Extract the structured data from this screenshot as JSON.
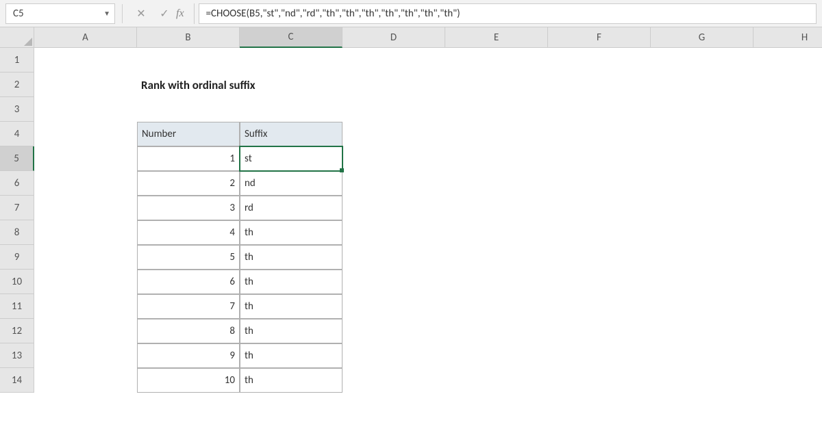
{
  "formula_bar": {
    "name_box": "C5",
    "formula": "=CHOOSE(B5,\"st\",\"nd\",\"rd\",\"th\",\"th\",\"th\",\"th\",\"th\",\"th\",\"th\")"
  },
  "columns": [
    "A",
    "B",
    "C",
    "D",
    "E",
    "F",
    "G",
    "H"
  ],
  "rows": [
    "1",
    "2",
    "3",
    "4",
    "5",
    "6",
    "7",
    "8",
    "9",
    "10",
    "11",
    "12",
    "13",
    "14"
  ],
  "title": "Rank with ordinal suffix",
  "table": {
    "headers": {
      "number": "Number",
      "suffix": "Suffix"
    },
    "rows": [
      {
        "number": "1",
        "suffix": "st"
      },
      {
        "number": "2",
        "suffix": "nd"
      },
      {
        "number": "3",
        "suffix": "rd"
      },
      {
        "number": "4",
        "suffix": "th"
      },
      {
        "number": "5",
        "suffix": "th"
      },
      {
        "number": "6",
        "suffix": "th"
      },
      {
        "number": "7",
        "suffix": "th"
      },
      {
        "number": "8",
        "suffix": "th"
      },
      {
        "number": "9",
        "suffix": "th"
      },
      {
        "number": "10",
        "suffix": "th"
      }
    ]
  },
  "selected_cell": "C5"
}
